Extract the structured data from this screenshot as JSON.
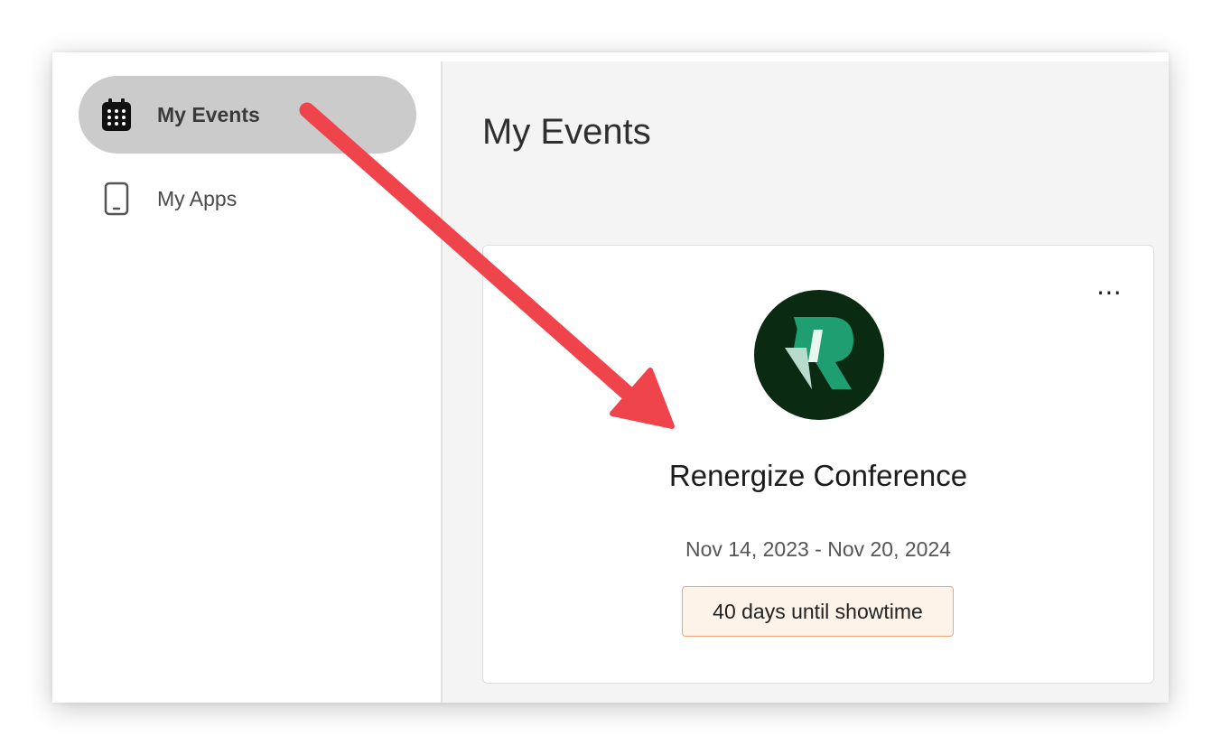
{
  "sidebar": {
    "items": [
      {
        "label": "My Events",
        "icon": "calendar-icon",
        "active": true
      },
      {
        "label": "My Apps",
        "icon": "phone-icon",
        "active": false
      }
    ]
  },
  "main": {
    "title": "My Events",
    "card": {
      "event_name": "Renergize Conference",
      "dates": "Nov 14, 2023 - Nov 20, 2024",
      "countdown": "40 days until showtime",
      "more_label": "⋯",
      "logo_icon": "renergize-logo"
    }
  },
  "colors": {
    "active_nav_bg": "#cbcbcb",
    "logo_bg": "#0b2a12",
    "logo_green": "#1f9e72",
    "badge_bg": "#fdf3e9",
    "badge_border": "#f0a576",
    "annotation_arrow": "#f0444c"
  }
}
